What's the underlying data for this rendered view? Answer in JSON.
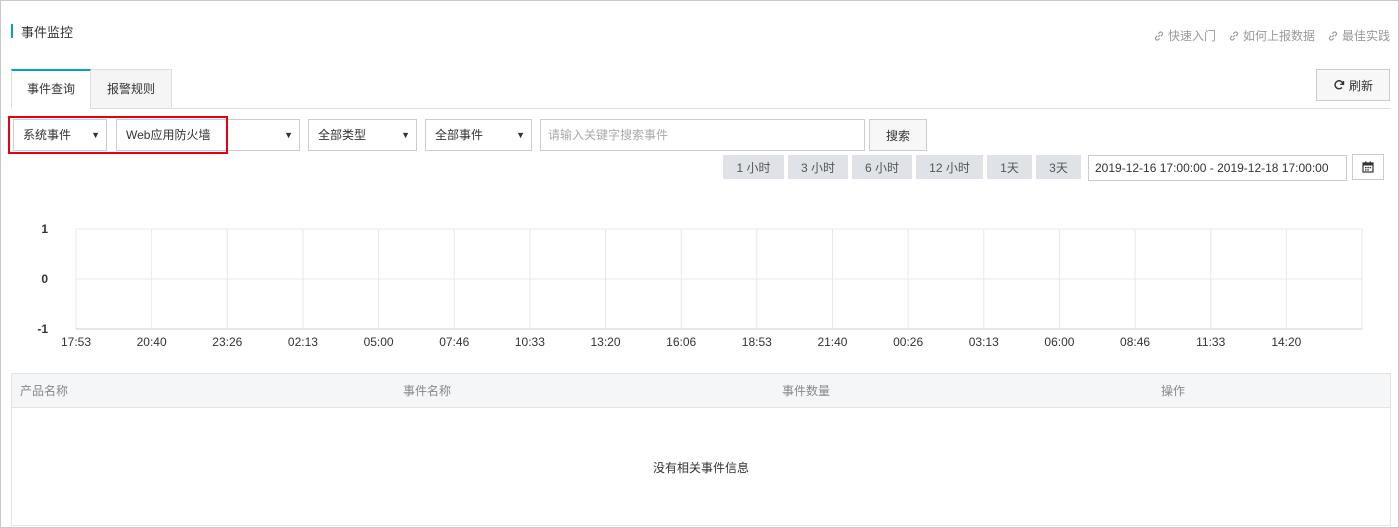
{
  "header": {
    "title": "事件监控",
    "links": [
      {
        "label": "快速入门",
        "icon": "link-icon"
      },
      {
        "label": "如何上报数据",
        "icon": "link-icon"
      },
      {
        "label": "最佳实践",
        "icon": "link-icon"
      }
    ]
  },
  "tabs": [
    {
      "label": "事件查询",
      "active": true
    },
    {
      "label": "报警规则",
      "active": false
    }
  ],
  "toolbar": {
    "refresh_label": "刷新",
    "event_scope": "系统事件",
    "product": "Web应用防火墙",
    "type_filter": "全部类型",
    "event_filter": "全部事件",
    "search_placeholder": "请输入关键字搜索事件",
    "search_label": "搜索",
    "caret": "▼"
  },
  "time_ranges": [
    "1 小时",
    "3 小时",
    "6 小时",
    "12 小时",
    "1天",
    "3天"
  ],
  "date_range": "2019-12-16 17:00:00 - 2019-12-18 17:00:00",
  "chart_data": {
    "type": "line",
    "x": [
      "17:53",
      "20:40",
      "23:26",
      "02:13",
      "05:00",
      "07:46",
      "10:33",
      "13:20",
      "16:06",
      "18:53",
      "21:40",
      "00:26",
      "03:13",
      "06:00",
      "08:46",
      "11:33",
      "14:20"
    ],
    "y_ticks": [
      "1",
      "0",
      "-1"
    ],
    "ylim": [
      -1,
      1
    ],
    "series": [],
    "grid": true
  },
  "table": {
    "columns": [
      "产品名称",
      "事件名称",
      "事件数量",
      "操作"
    ],
    "empty_text": "没有相关事件信息"
  },
  "colors": {
    "accent": "#00a2ca",
    "highlight": "#e60012"
  }
}
